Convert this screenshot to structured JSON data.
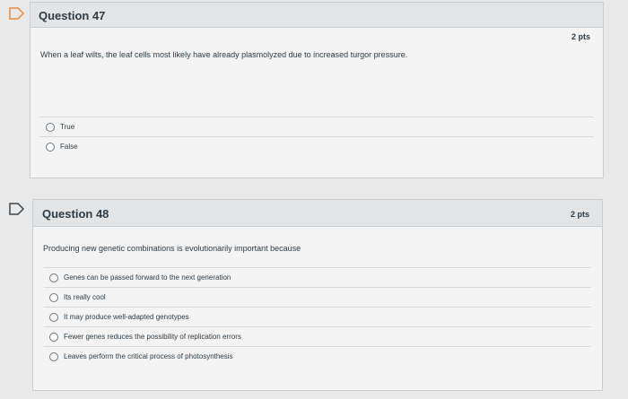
{
  "q47": {
    "title": "Question 47",
    "points": "2 pts",
    "text": "When a leaf wilts, the leaf cells most likely have already plasmolyzed due to increased turgor pressure.",
    "answers": [
      "True",
      "False"
    ]
  },
  "q48": {
    "title": "Question 48",
    "points": "2 pts",
    "text": "Producing new genetic combinations is evolutionarily important because",
    "answers": [
      "Genes can be passed forward to the next generation",
      "Its really cool",
      "It may produce well-adapted genotypes",
      "Fewer genes reduces the possibility of replication errors",
      "Leaves perform the critical process of photosynthesis"
    ]
  },
  "colors": {
    "card_bg": "#f4f4f4",
    "header_bg": "#e3e4e5",
    "border": "#c7cdd1",
    "flag_icon": "#e98b3c"
  }
}
